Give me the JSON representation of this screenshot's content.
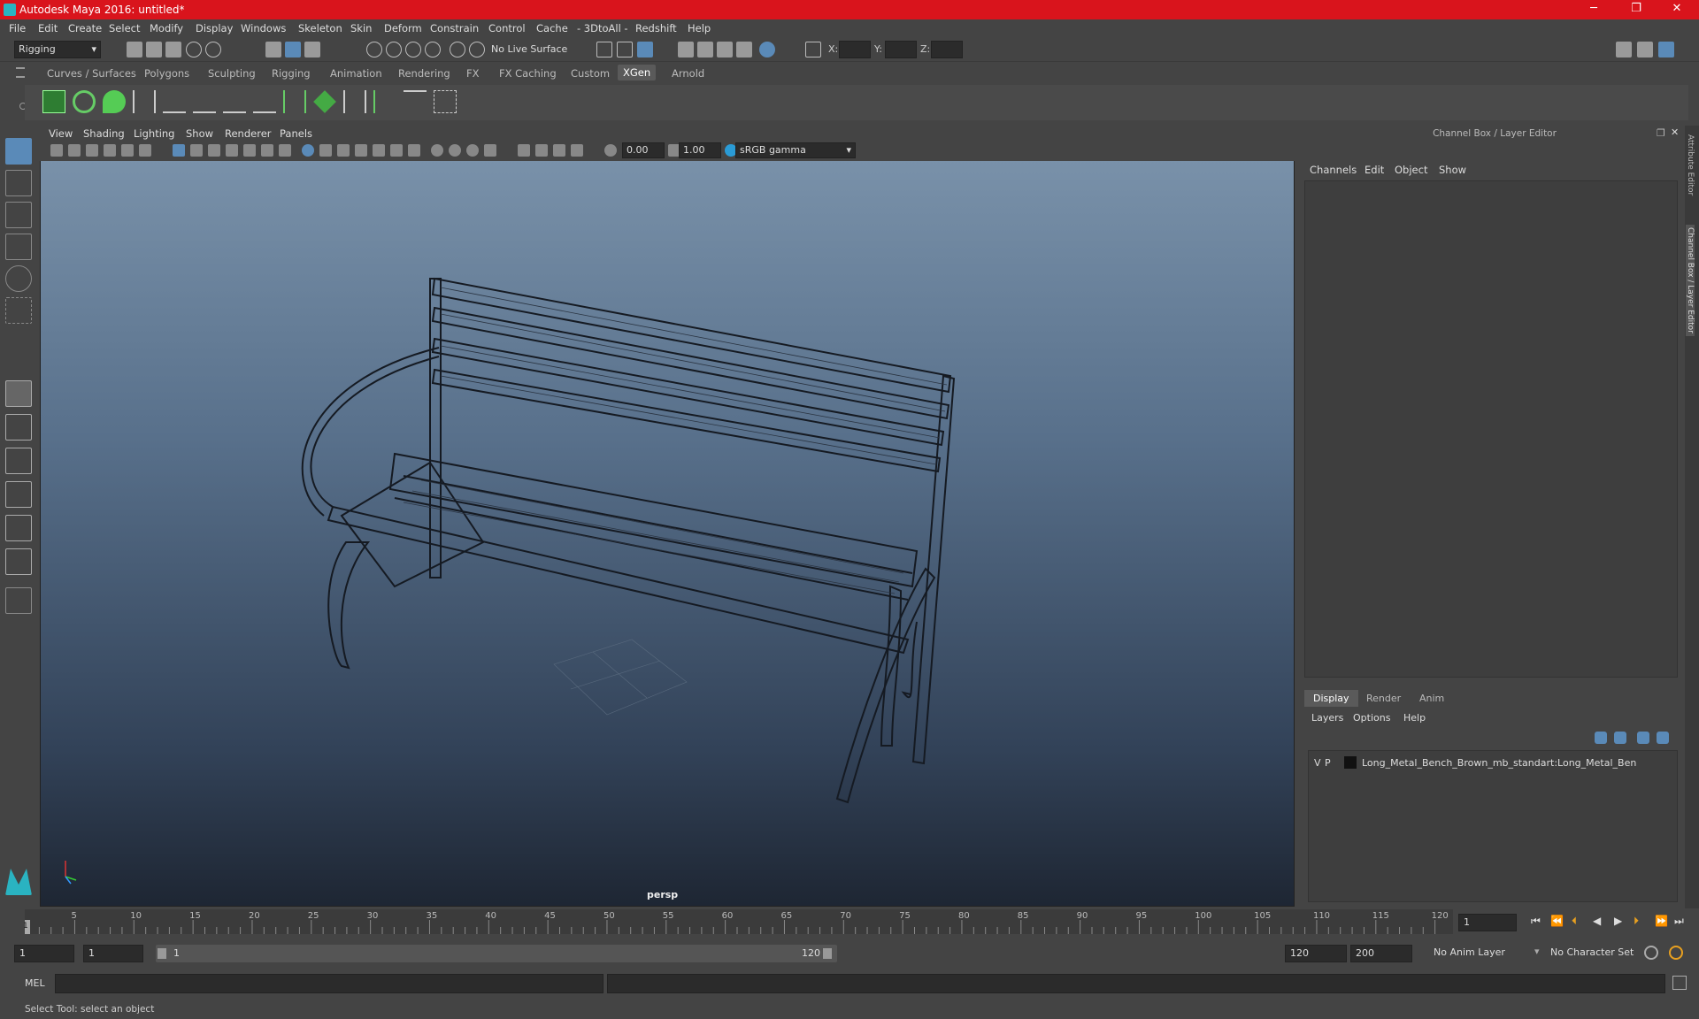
{
  "window": {
    "title": "Autodesk Maya 2016: untitled*",
    "minimize": "─",
    "restore": "❐",
    "close": "✕"
  },
  "menus": [
    "File",
    "Edit",
    "Create",
    "Select",
    "Modify",
    "Display",
    "Windows",
    "Skeleton",
    "Skin",
    "Deform",
    "Constrain",
    "Control",
    "Cache",
    "- 3DtoAll -",
    "Redshift",
    "Help"
  ],
  "status": {
    "menuset": "Rigging",
    "live_surface": "No Live Surface",
    "x_label": "X:",
    "y_label": "Y:",
    "z_label": "Z:"
  },
  "shelf_tabs": [
    "Curves / Surfaces",
    "Polygons",
    "Sculpting",
    "Rigging",
    "Animation",
    "Rendering",
    "FX",
    "FX Caching",
    "Custom",
    "XGen",
    "Arnold"
  ],
  "shelf_active": "XGen",
  "viewport": {
    "menus": [
      "View",
      "Shading",
      "Lighting",
      "Show",
      "Renderer",
      "Panels"
    ],
    "exposure": "0.00",
    "gamma": "1.00",
    "color_space": "sRGB gamma",
    "camera": "persp"
  },
  "channel_box": {
    "title": "Channel Box / Layer Editor",
    "menus": [
      "Channels",
      "Edit",
      "Object",
      "Show"
    ]
  },
  "layer_editor": {
    "tabs": [
      "Display",
      "Render",
      "Anim"
    ],
    "active": "Display",
    "menus": [
      "Layers",
      "Options",
      "Help"
    ],
    "layer": {
      "v": "V",
      "p": "P",
      "name": "Long_Metal_Bench_Brown_mb_standart:Long_Metal_Ben"
    }
  },
  "side_tabs": [
    "Attribute Editor",
    "Channel Box / Layer Editor"
  ],
  "timeline": {
    "ticks": [
      "5",
      "10",
      "15",
      "20",
      "25",
      "30",
      "35",
      "40",
      "45",
      "50",
      "55",
      "60",
      "65",
      "70",
      "75",
      "80",
      "85",
      "90",
      "95",
      "100",
      "105",
      "110",
      "115",
      "120"
    ],
    "current_frame": "1",
    "start_marker": "1"
  },
  "range": {
    "start": "1",
    "playback_start": "1",
    "slider_start": "1",
    "slider_end": "120",
    "playback_end": "120",
    "end": "200",
    "anim_layer": "No Anim Layer",
    "char_set": "No Character Set"
  },
  "cmdline": {
    "lang": "MEL"
  },
  "help": "Select Tool: select an object"
}
